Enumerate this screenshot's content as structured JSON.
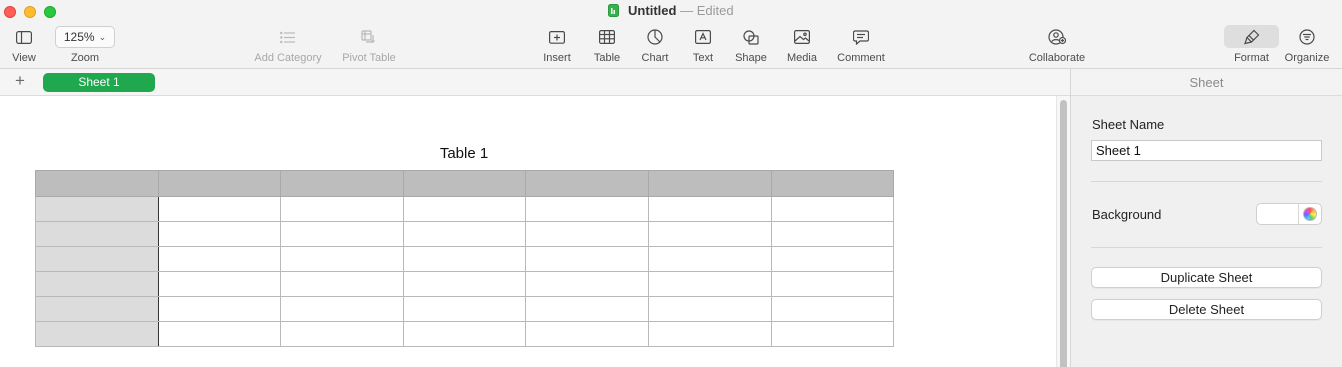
{
  "window": {
    "title": "Untitled",
    "title_separator": "—",
    "status": "Edited"
  },
  "toolbar": {
    "view_label": "View",
    "zoom_value": "125%",
    "zoom_label": "Zoom",
    "add_category_label": "Add Category",
    "pivot_table_label": "Pivot Table",
    "insert_label": "Insert",
    "table_label": "Table",
    "chart_label": "Chart",
    "text_label": "Text",
    "shape_label": "Shape",
    "media_label": "Media",
    "comment_label": "Comment",
    "collaborate_label": "Collaborate",
    "format_label": "Format",
    "organize_label": "Organize"
  },
  "tabs": {
    "add_symbol": "+",
    "sheets": [
      "Sheet 1"
    ]
  },
  "canvas": {
    "table_title": "Table 1",
    "columns": 7,
    "rows": 7
  },
  "inspector": {
    "header": "Sheet",
    "sheet_name_label": "Sheet Name",
    "sheet_name_value": "Sheet 1",
    "background_label": "Background",
    "duplicate_button": "Duplicate Sheet",
    "delete_button": "Delete Sheet"
  },
  "colors": {
    "accent_tab": "#1fa84e",
    "header_row": "#bdbdbd",
    "header_column": "#dcdcdc"
  }
}
